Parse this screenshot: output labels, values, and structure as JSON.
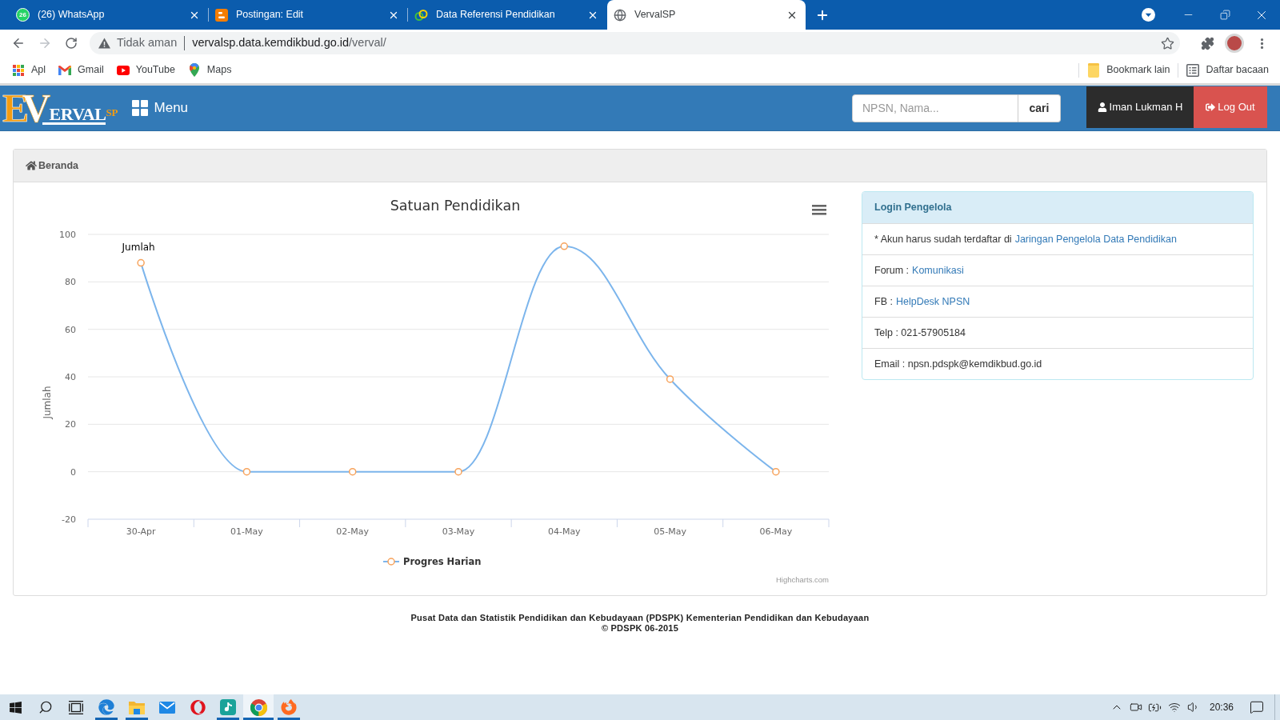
{
  "browser": {
    "tabs": [
      {
        "title": "(26) WhatsApp",
        "kind": "whatsapp",
        "favicon_badge": "26",
        "selected": false
      },
      {
        "title": "Postingan: Edit",
        "kind": "blogger",
        "selected": false
      },
      {
        "title": "Data Referensi Pendidikan",
        "kind": "rings",
        "selected": false
      },
      {
        "title": "VervalSP",
        "kind": "globe",
        "selected": true
      }
    ],
    "nav": {
      "back_disabled": false,
      "forward_disabled": true
    },
    "address": {
      "security": "Tidak aman",
      "host": "vervalsp.data.kemdikbud.go.id",
      "path": "/verval/"
    },
    "bookmarks": [
      {
        "label": "Apl",
        "kind": "apps"
      },
      {
        "label": "Gmail",
        "kind": "gmail"
      },
      {
        "label": "YouTube",
        "kind": "youtube"
      },
      {
        "label": "Maps",
        "kind": "maps"
      }
    ],
    "bookmarks_right": [
      {
        "label": "Bookmark lain",
        "kind": "folder"
      },
      {
        "label": "Daftar bacaan",
        "kind": "reading-list"
      }
    ]
  },
  "navbar": {
    "logo": {
      "first": "E",
      "second": "V",
      "word": "ERVAL",
      "suffix": "SP"
    },
    "menu": "Menu",
    "search": {
      "placeholder": "NPSN, Nama..."
    },
    "search_button": "cari",
    "user": "Iman Lukman H",
    "logout": "Log Out"
  },
  "breadcrumb": {
    "label": "Beranda"
  },
  "chart": {
    "chart_data": {
      "type": "line",
      "title": "Satuan Pendidikan",
      "ylabel": "Jumlah",
      "categories": [
        "30-Apr",
        "01-May",
        "02-May",
        "03-May",
        "04-May",
        "05-May",
        "06-May"
      ],
      "series": [
        {
          "name": "Progres Harian",
          "color": "#7cb5ec",
          "marker": true,
          "values": [
            88,
            0,
            0,
            0,
            95,
            39,
            0
          ]
        }
      ],
      "ylim": [
        -20,
        100
      ],
      "yticks": [
        -20,
        0,
        20,
        40,
        60,
        80,
        100
      ],
      "grid": true,
      "annotations": [
        {
          "x": "30-Apr",
          "y": 88,
          "text": "Jumlah"
        }
      ]
    },
    "credits": "Highcharts.com"
  },
  "info_panel": {
    "title": "Login Pengelola",
    "rows": [
      {
        "text": "* Akun harus sudah terdaftar di",
        "link": "Jaringan Pengelola Data Pendidikan"
      },
      {
        "text": "Forum :",
        "link": "Komunikasi"
      },
      {
        "text": "FB :",
        "link": "HelpDesk NPSN"
      },
      {
        "text": "Telp : 021-57905184"
      },
      {
        "text": "Email : npsn.pdspk@kemdikbud.go.id"
      }
    ]
  },
  "footer": {
    "lines": [
      "Pusat Data dan Statistik Pendidikan dan Kebudayaan (PDSPK) Kementerian Pendidikan dan Kebudayaan",
      "© PDSPK 06-2015"
    ]
  },
  "taskbar": {
    "apps": [
      {
        "kind": "edge",
        "running": true,
        "selected": false
      },
      {
        "kind": "files",
        "running": true,
        "selected": false
      },
      {
        "kind": "mail",
        "running": false,
        "selected": false
      },
      {
        "kind": "opera",
        "running": false,
        "selected": false
      },
      {
        "kind": "music",
        "running": true,
        "selected": false
      },
      {
        "kind": "chrome",
        "running": true,
        "selected": true
      },
      {
        "kind": "firefox",
        "running": true,
        "selected": false
      }
    ],
    "time": "20:36"
  }
}
